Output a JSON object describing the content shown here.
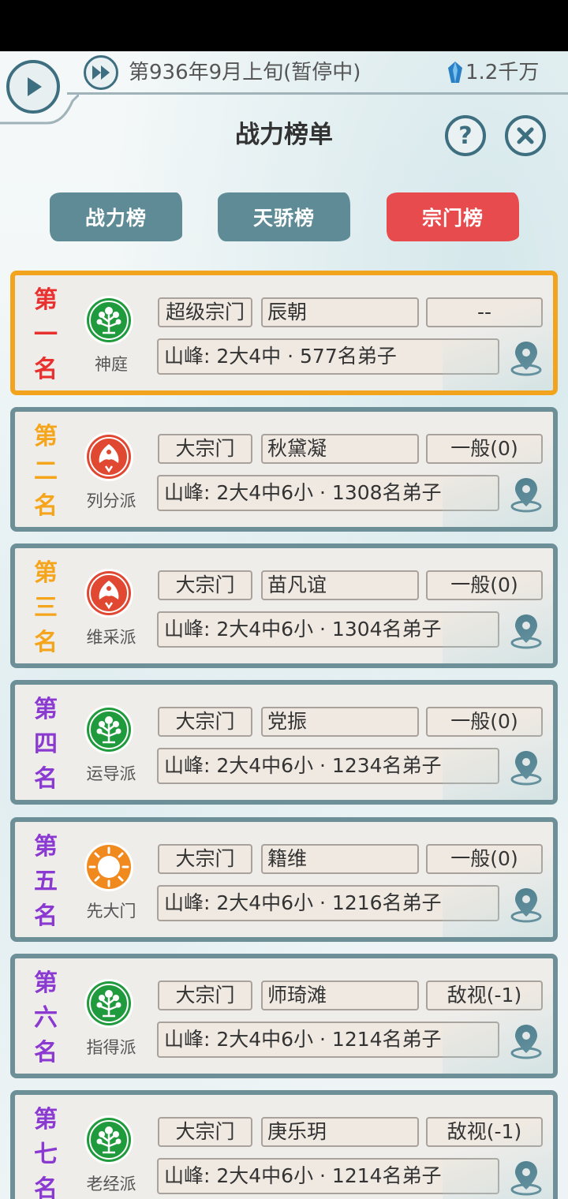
{
  "header": {
    "date": "第936年9月上旬(暂停中)",
    "currency": "1.2千万",
    "title": "战力榜单",
    "help": "?"
  },
  "tabs": [
    {
      "label": "战力榜",
      "active": false
    },
    {
      "label": "天骄榜",
      "active": false
    },
    {
      "label": "宗门榜",
      "active": true
    }
  ],
  "colors": {
    "accent_teal": "#3d6f80",
    "tab_teal": "#5e8b95",
    "tab_active_red": "#e74b4d",
    "first_place_border": "#f3a41e",
    "card_border": "#6c8f98"
  },
  "ranks": [
    {
      "rank": [
        "第",
        "一",
        "名"
      ],
      "rank_color": "#e8312f",
      "emblem": "tree-emblem",
      "name": "神庭",
      "type": "超级宗门",
      "leader": "辰朝",
      "relation": "--",
      "peaks": "山峰: 2大4中 · 577名弟子"
    },
    {
      "rank": [
        "第",
        "二",
        "名"
      ],
      "rank_color": "#f5a51c",
      "emblem": "phoenix-emblem",
      "name": "列分派",
      "type": "大宗门",
      "leader": "秋黛凝",
      "relation": "一般(0)",
      "peaks": "山峰: 2大4中6小 · 1308名弟子"
    },
    {
      "rank": [
        "第",
        "三",
        "名"
      ],
      "rank_color": "#f5a51c",
      "emblem": "phoenix-emblem",
      "name": "维采派",
      "type": "大宗门",
      "leader": "苗凡谊",
      "relation": "一般(0)",
      "peaks": "山峰: 2大4中6小 · 1304名弟子"
    },
    {
      "rank": [
        "第",
        "四",
        "名"
      ],
      "rank_color": "#8a3ad0",
      "emblem": "tree-emblem",
      "name": "运导派",
      "type": "大宗门",
      "leader": "党振",
      "relation": "一般(0)",
      "peaks": "山峰: 2大4中6小 · 1234名弟子"
    },
    {
      "rank": [
        "第",
        "五",
        "名"
      ],
      "rank_color": "#8a3ad0",
      "emblem": "sun-emblem",
      "name": "先大门",
      "type": "大宗门",
      "leader": "籍维",
      "relation": "一般(0)",
      "peaks": "山峰: 2大4中6小 · 1216名弟子"
    },
    {
      "rank": [
        "第",
        "六",
        "名"
      ],
      "rank_color": "#8a3ad0",
      "emblem": "tree-emblem",
      "name": "指得派",
      "type": "大宗门",
      "leader": "师琦滩",
      "relation": "敌视(-1)",
      "peaks": "山峰: 2大4中6小 · 1214名弟子"
    },
    {
      "rank": [
        "第",
        "七",
        "名"
      ],
      "rank_color": "#8a3ad0",
      "emblem": "tree-emblem",
      "name": "老经派",
      "type": "大宗门",
      "leader": "庚乐玥",
      "relation": "敌视(-1)",
      "peaks": "山峰: 2大4中6小 · 1214名弟子"
    }
  ]
}
